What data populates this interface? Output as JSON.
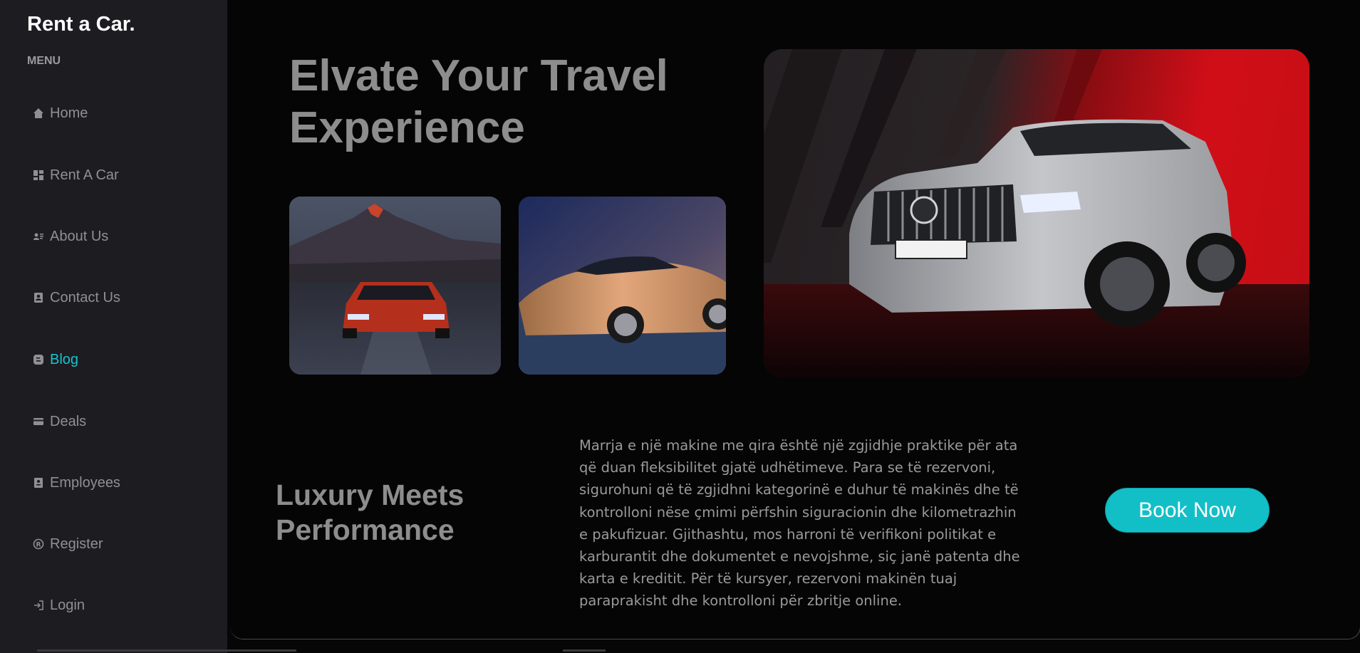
{
  "sidebar": {
    "brand": "Rent a Car.",
    "menu_label": "MENU",
    "items": [
      {
        "label": "Home",
        "icon": "home-icon"
      },
      {
        "label": "Rent A Car",
        "icon": "dashboard-icon"
      },
      {
        "label": "About Us",
        "icon": "contact-card-icon"
      },
      {
        "label": "Contact Us",
        "icon": "address-book-icon"
      },
      {
        "label": "Blog",
        "icon": "blog-icon",
        "active": true
      },
      {
        "label": "Deals",
        "icon": "credit-card-icon"
      },
      {
        "label": "Employees",
        "icon": "badge-icon"
      },
      {
        "label": "Register",
        "icon": "registered-icon"
      },
      {
        "label": "Login",
        "icon": "login-icon"
      }
    ]
  },
  "hero": {
    "title": "Elvate Your Travel Experience"
  },
  "section": {
    "title": "Luxury Meets Performance",
    "paragraph": "Marrja e një makine me qira është një zgjidhje praktike për ata që duan fleksibilitet gjatë udhëtimeve. Para se të rezervoni, sigurohuni që të zgjidhni kategorinë e duhur të makinës dhe të kontrolloni nëse çmimi përfshin siguracionin dhe kilometrazhin e pakufizuar. Gjithashtu, mos harroni të verifikoni politikat e karburantit dhe dokumentet e nevojshme, siç janë patenta dhe karta e kreditit. Për të kursyer, rezervoni makinën tuaj paraprakisht dhe kontrolloni për zbritje online.",
    "button_label": "Book Now"
  },
  "colors": {
    "accent": "#13bfc7",
    "sidebar_bg": "#1c1c21",
    "main_bg": "#050505",
    "heading": "#8d8d8d"
  }
}
